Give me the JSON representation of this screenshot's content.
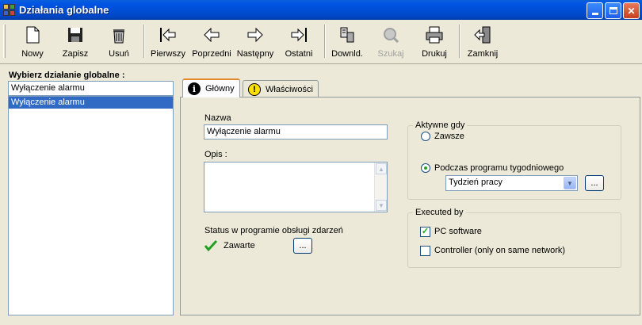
{
  "window": {
    "title": "Działania globalne"
  },
  "toolbar": {
    "new": "Nowy",
    "save": "Zapisz",
    "delete": "Usuń",
    "first": "Pierwszy",
    "prev": "Poprzedni",
    "next": "Następny",
    "last": "Ostatni",
    "download": "Downld.",
    "search": "Szukaj",
    "print": "Drukuj",
    "close": "Zamknij"
  },
  "left": {
    "label": "Wybierz działanie globalne :",
    "search_value": "Wyłączenie alarmu",
    "items": [
      "Wyłączenie alarmu"
    ]
  },
  "tabs": [
    {
      "label": "Główny"
    },
    {
      "label": "Właściwości"
    }
  ],
  "main": {
    "name_label": "Nazwa",
    "name_value": "Wyłączenie alarmu",
    "desc_label": "Opis :",
    "desc_value": "",
    "status_label": "Status w programie obsługi zdarzeń",
    "status_value": "Zawarte",
    "ellipsis": "..."
  },
  "active_when": {
    "title": "Aktywne gdy",
    "opt_always": "Zawsze",
    "opt_weekly": "Podczas programu tygodniowego",
    "selected": "opt_weekly",
    "schedule_value": "Tydzień pracy",
    "ellipsis": "..."
  },
  "executed_by": {
    "title": "Executed by",
    "pc": "PC software",
    "pc_checked": true,
    "controller": "Controller (only on same network)",
    "controller_checked": false
  },
  "colors": {
    "titlebar": "#0054e3",
    "selection": "#316ac5",
    "status_ok": "#21a121"
  }
}
